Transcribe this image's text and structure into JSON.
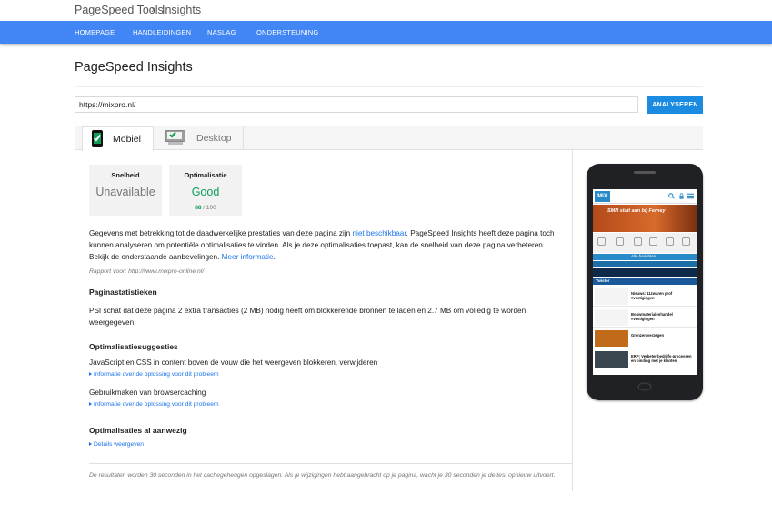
{
  "breadcrumb": {
    "root": "PageSpeed Tools",
    "current": "Insights"
  },
  "nav": {
    "items": [
      "HOMEPAGE",
      "HANDLEIDINGEN",
      "NASLAG",
      "ONDERSTEUNING"
    ]
  },
  "page": {
    "title": "PageSpeed Insights"
  },
  "form": {
    "url_value": "https://mixpro.nl/",
    "analyze_label": "ANALYSEREN"
  },
  "tabs": {
    "mobile": "Mobiel",
    "desktop": "Desktop",
    "active": "mobile"
  },
  "scores": {
    "speed": {
      "title": "Snelheid",
      "value": "Unavailable"
    },
    "optimization": {
      "title": "Optimalisatie",
      "value": "Good",
      "score": "88",
      "max": "/ 100",
      "color": "#0f9d58"
    }
  },
  "summary": {
    "text_1": "Gegevens met betrekking tot de daadwerkelijke prestaties van deze pagina zijn ",
    "link_1": "niet beschikbaar",
    "text_2": ". PageSpeed Insights heeft deze pagina toch kunnen analyseren om potentiële optimalisaties te vinden. Als je deze optimalisaties toepast, kan de snelheid van deze pagina verbeteren. Bekijk de onderstaande aanbevelingen. ",
    "link_2": "Meer informatie",
    "text_3": "."
  },
  "report": "Rapport voor: http://www.mixpro-online.nl/",
  "stats": {
    "heading": "Paginastatistieken",
    "text": "PSI schat dat deze pagina 2 extra transacties (2 MB) nodig heeft om blokkerende bronnen te laden en 2.7 MB om volledig te worden weergegeven."
  },
  "suggestions": {
    "heading": "Optimalisatiesuggesties",
    "items": [
      {
        "title": "JavaScript en CSS in content boven de vouw die het weergeven blokkeren, verwijderen",
        "link": "Informatie over de oplossing voor dit probleem"
      },
      {
        "title": "Gebruikmaken van browsercaching",
        "link": "Informatie over de oplossing voor dit probleem"
      }
    ]
  },
  "present": {
    "heading": "Optimalisaties al aanwezig",
    "link": "Details weergeven"
  },
  "footer_note": "De resultaten worden 30 seconden in het cachegeheugen opgeslagen. Als je wijzigingen hebt aangebracht op je pagina, wacht je 30 seconden je de test opnieuw uitvoert.",
  "preview": {
    "logo": "MIX",
    "banner": "SMN sluit aan bij Ferney",
    "bar_label": "Alle berichten",
    "blue_label": "Twister",
    "rows": [
      "Nieuws: 11zwaren prof #vestigingen",
      "Bouwmaterialenhandel #vestigingen",
      "Grenzen verzegen",
      "ERP: Verbeter bedrijfs-processen en binding met je klanten"
    ],
    "colors": {
      "brand": "#2a8ac8",
      "accent": "#4285f4"
    }
  }
}
